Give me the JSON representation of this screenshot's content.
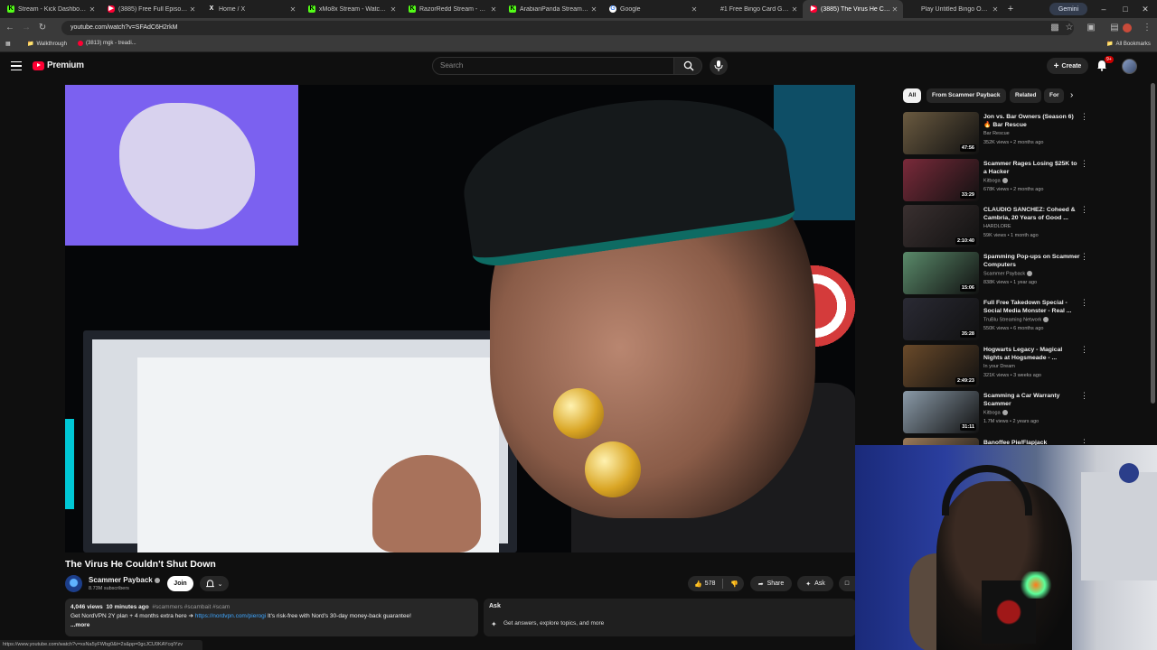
{
  "browser": {
    "tabs": [
      {
        "label": "Stream - Kick Dashboard",
        "icon": "kick-icon",
        "active": false
      },
      {
        "label": "(3885) Free Full Episode - Ti",
        "icon": "youtube-icon",
        "active": false
      },
      {
        "label": "Home / X",
        "icon": "x-icon",
        "active": false
      },
      {
        "label": "xMo8x Stream - Watch Live",
        "icon": "kick-icon",
        "active": false
      },
      {
        "label": "RazorRedd Stream - Watch",
        "icon": "kick-icon",
        "active": false
      },
      {
        "label": "ArabianPanda Stream - Watc",
        "icon": "kick-icon",
        "active": false
      },
      {
        "label": "Google",
        "icon": "google-icon",
        "active": false
      },
      {
        "label": "#1 Free Bingo Card Generato",
        "icon": "bingo-icon",
        "active": false
      },
      {
        "label": "(3885) The Virus He Cou",
        "icon": "youtube-icon",
        "active": true
      },
      {
        "label": "Play Untitled Bingo Online |",
        "icon": "bingo-icon",
        "active": false
      }
    ],
    "gemini_label": "Gemini",
    "url": "youtube.com/watch?v=SFAdC6H2rkM",
    "bookmarks": [
      {
        "label": "Walkthrough"
      },
      {
        "label": "(3813) mgk - treadi..."
      }
    ],
    "all_bookmarks_label": "All Bookmarks",
    "status_url": "https://www.youtube.com/watch?v=xsNa5yFWbg0&t=2s&pp=0gcJCU0KAYcqIYzv"
  },
  "header": {
    "logo_label": "Premium",
    "search_placeholder": "Search",
    "create_label": "Create",
    "notification_count": "9+"
  },
  "video": {
    "title": "The Virus He Couldn't Shut Down",
    "channel_name": "Scammer Payback",
    "subscribers": "8.73M subscribers",
    "join_label": "Join",
    "like_count": "578",
    "share_label": "Share",
    "ask_label": "Ask",
    "description": {
      "views": "4,046 views",
      "time": "10 minutes ago",
      "tags": "#scammers #scambait #scam",
      "line2": "Get NordVPN 2Y plan + 4 months extra here ➔",
      "link": "https://nordvpn.com/pierogi",
      "line2_tail": "It's risk-free with Nord's 30-day money-back guarantee!",
      "more": "...more"
    },
    "ask_panel": {
      "heading": "Ask",
      "prompt": "Get answers, explore topics, and more"
    }
  },
  "chips": [
    {
      "label": "All",
      "selected": true
    },
    {
      "label": "From Scammer Payback",
      "selected": false
    },
    {
      "label": "Related",
      "selected": false
    },
    {
      "label": "For",
      "selected": false
    }
  ],
  "recommendations": [
    {
      "title": "Jon vs. Bar Owners (Season 6) 🔥 Bar Rescue",
      "channel": "Bar Rescue",
      "meta": "352K views • 2 months ago",
      "duration": "47:56",
      "verified": false,
      "thumb": "#6a5a40"
    },
    {
      "title": "Scammer Rages Losing $25K to a Hacker",
      "channel": "Kitboga",
      "meta": "678K views • 2 months ago",
      "duration": "33:29",
      "verified": true,
      "thumb": "#7a2a3a"
    },
    {
      "title": "CLAUDIO SANCHEZ: Coheed & Cambria, 20 Years of Good ...",
      "channel": "HARDLORE",
      "meta": "59K views • 1 month ago",
      "duration": "2:10:40",
      "verified": false,
      "thumb": "#3a3030"
    },
    {
      "title": "Spamming Pop-ups on Scammer Computers",
      "channel": "Scammer Payback",
      "meta": "838K views • 1 year ago",
      "duration": "15:06",
      "verified": true,
      "thumb": "#5a8a6a"
    },
    {
      "title": "Full Free Takedown Special - Social Media Monster - Real ...",
      "channel": "TruBlu Streaming Network",
      "meta": "550K views • 6 months ago",
      "duration": "35:28",
      "verified": true,
      "thumb": "#2a2a34"
    },
    {
      "title": "Hogwarts Legacy - Magical Nights at Hogsmeade - ...",
      "channel": "In your Dream",
      "meta": "321K views • 3 weeks ago",
      "duration": "2:49:23",
      "verified": false,
      "thumb": "#6a4a2a"
    },
    {
      "title": "Scamming a Car Warranty Scammer",
      "channel": "Kitboga",
      "meta": "1.7M views • 2 years ago",
      "duration": "31:11",
      "verified": true,
      "thumb": "#8a9aa8"
    },
    {
      "title": "Banoffee Pie/Flapjack",
      "channel": "",
      "meta": "",
      "duration": "",
      "verified": false,
      "thumb": "#9a7a5a"
    }
  ]
}
